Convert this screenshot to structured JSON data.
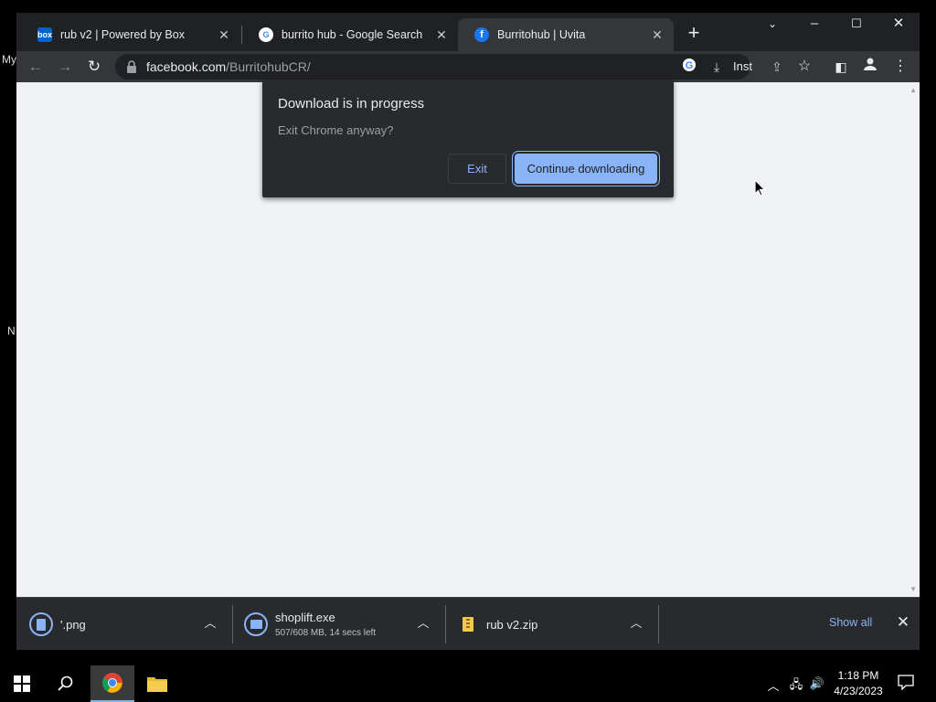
{
  "desktop": {
    "fragments": [
      "My",
      "N"
    ]
  },
  "tabs": [
    {
      "title": "rub v2 | Powered by Box",
      "favicon": "box-icon",
      "favicon_text": "box",
      "color": "#0061d5",
      "active": false
    },
    {
      "title": "burrito hub - Google Search",
      "favicon": "google-icon",
      "favicon_text": "G",
      "color": "#4285f4",
      "active": false
    },
    {
      "title": "Burritohub | Uvita",
      "favicon": "facebook-icon",
      "favicon_text": "f",
      "color": "#1877f2",
      "active": true
    }
  ],
  "toolbar": {
    "url_domain": "facebook.com",
    "url_path": "/BurritohubCR/",
    "install_label": "Inst"
  },
  "dialog": {
    "title": "Download is in progress",
    "message": "Exit Chrome anyway?",
    "exit_label": "Exit",
    "continue_label": "Continue downloading"
  },
  "downloads": {
    "items": [
      {
        "name": "'.png",
        "status": ""
      },
      {
        "name": "shoplift.exe",
        "status": "507/608 MB, 14 secs left"
      },
      {
        "name": "rub v2.zip",
        "status": ""
      }
    ],
    "show_all_label": "Show all"
  },
  "taskbar": {
    "time": "1:18 PM",
    "date": "4/23/2023"
  },
  "colors": {
    "accent": "#8ab4f8",
    "frame": "#202124",
    "toolbar": "#35363a"
  }
}
